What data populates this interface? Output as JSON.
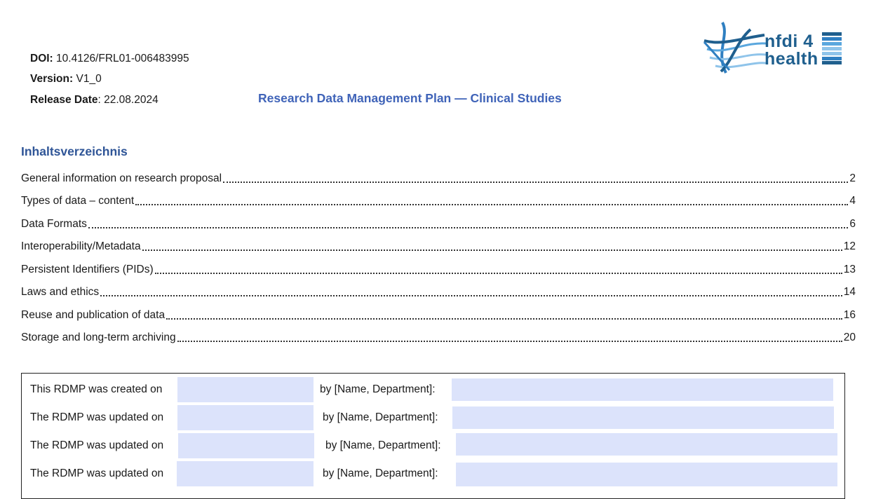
{
  "header": {
    "doi_label": "DOI:",
    "doi_value": "10.4126/FRL01-006483995",
    "version_label": "Version:",
    "version_value": "V1_0",
    "release_label": "Release Date",
    "release_value": ": 22.08.2024",
    "title": "Research Data Management Plan — Clinical Studies"
  },
  "logo": {
    "line1": "nfdi 4",
    "line2": "health",
    "colors": {
      "dark": "#1f5f8e",
      "mid": "#2f7fc1",
      "light": "#8fc4ea"
    }
  },
  "toc": {
    "heading": "Inhaltsverzeichnis",
    "items": [
      {
        "title": "General information on research proposal",
        "page": "2"
      },
      {
        "title": "Types of data – content",
        "page": "4"
      },
      {
        "title": "Data Formats",
        "page": "6"
      },
      {
        "title": "Interoperability/Metadata",
        "page": "12"
      },
      {
        "title": "Persistent Identifiers (PIDs)",
        "page": "13"
      },
      {
        "title": "Laws and ethics",
        "page": "14"
      },
      {
        "title": "Reuse and publication of data",
        "page": "16"
      },
      {
        "title": "Storage and long-term archiving",
        "page": "20"
      }
    ]
  },
  "rdmp_table": {
    "rows": [
      {
        "label": "This RDMP was created on",
        "date_value": "",
        "by_label": "by [Name, Department]:",
        "name_value": ""
      },
      {
        "label": "The RDMP was updated on",
        "date_value": "",
        "by_label": "by [Name, Department]:",
        "name_value": ""
      },
      {
        "label": "The RDMP was updated on",
        "date_value": "",
        "by_label": "by [Name, Department]:",
        "name_value": ""
      },
      {
        "label": "The RDMP was updated on",
        "date_value": "",
        "by_label": "by [Name, Department]:",
        "name_value": ""
      }
    ],
    "field_color": "#dce3fb"
  }
}
